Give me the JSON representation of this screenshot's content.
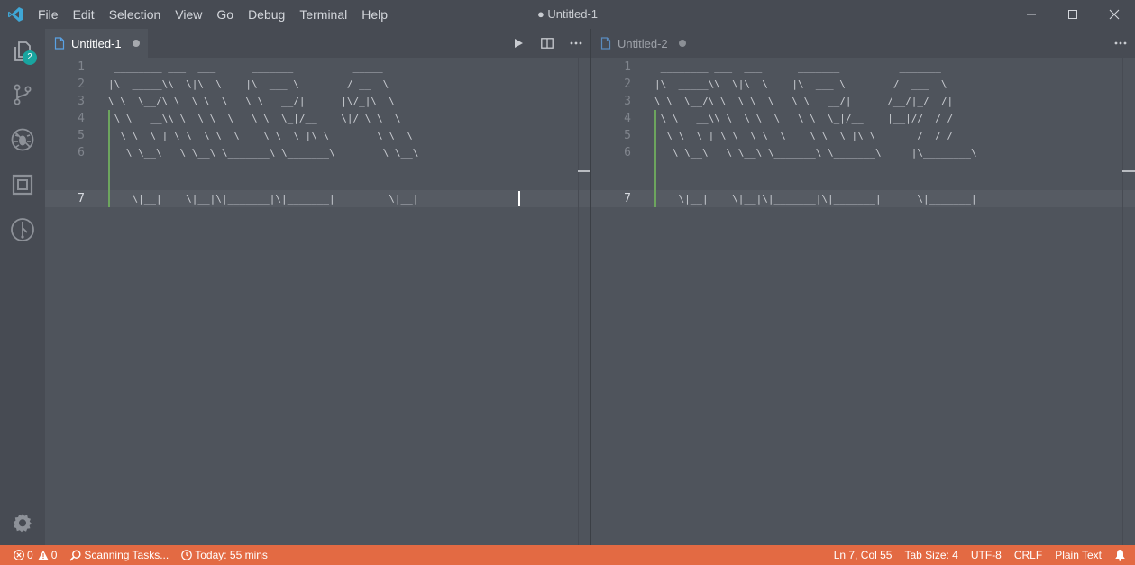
{
  "window": {
    "title": "● Untitled-1",
    "menu": [
      "File",
      "Edit",
      "Selection",
      "View",
      "Go",
      "Debug",
      "Terminal",
      "Help"
    ]
  },
  "activity_bar": {
    "explorer_badge": "2"
  },
  "editor_left": {
    "tab_label": "Untitled-1",
    "line_numbers": [
      "1",
      "2",
      "3",
      "4",
      "5",
      "6",
      "7"
    ],
    "lines": [
      " ________ ___  ___      _______          _____",
      "|\\  _____\\\\  \\|\\  \\    |\\  ___ \\        / __  \\",
      "\\ \\  \\__/\\ \\  \\ \\  \\   \\ \\   __/|      |\\/_|\\  \\",
      " \\ \\   __\\\\ \\  \\ \\  \\   \\ \\  \\_|/__    \\|/ \\ \\  \\",
      "  \\ \\  \\_| \\ \\  \\ \\  \\____\\ \\  \\_|\\ \\        \\ \\  \\",
      "   \\ \\__\\   \\ \\__\\ \\_______\\ \\_______\\        \\ \\__\\",
      "    \\|__|    \\|__|\\|_______|\\|_______|         \\|__|"
    ]
  },
  "editor_right": {
    "tab_label": "Untitled-2",
    "line_numbers": [
      "1",
      "2",
      "3",
      "4",
      "5",
      "6",
      "7"
    ],
    "lines": [
      " ________ ___  ___      _______          _______",
      "|\\  _____\\\\  \\|\\  \\    |\\  ___ \\        /  ___  \\",
      "\\ \\  \\__/\\ \\  \\ \\  \\   \\ \\   __/|      /__/|_/  /|",
      " \\ \\   __\\\\ \\  \\ \\  \\   \\ \\  \\_|/__    |__|//  / /",
      "  \\ \\  \\_| \\ \\  \\ \\  \\____\\ \\  \\_|\\ \\       /  /_/__",
      "   \\ \\__\\   \\ \\__\\ \\_______\\ \\_______\\     |\\________\\",
      "    \\|__|    \\|__|\\|_______|\\|_______|      \\|_______|"
    ]
  },
  "status_bar": {
    "errors": "0",
    "warnings": "0",
    "tasks": "Scanning Tasks...",
    "time": "Today: 55 mins",
    "position": "Ln 7, Col 55",
    "tab_size": "Tab Size: 4",
    "encoding": "UTF-8",
    "eol": "CRLF",
    "language": "Plain Text"
  },
  "colors": {
    "status_bar": "#e36a43",
    "badge": "#19a5a0",
    "modified_gutter": "#6da55e"
  },
  "icons": [
    "vscode-logo-icon",
    "minimize-icon",
    "maximize-icon",
    "close-icon",
    "files-icon",
    "source-control-icon",
    "debug-icon",
    "extensions-icon",
    "timeline-icon",
    "gear-icon",
    "file-icon",
    "run-icon",
    "split-editor-icon",
    "more-icon",
    "error-icon",
    "warning-icon",
    "search-icon",
    "clock-icon",
    "bell-icon"
  ]
}
